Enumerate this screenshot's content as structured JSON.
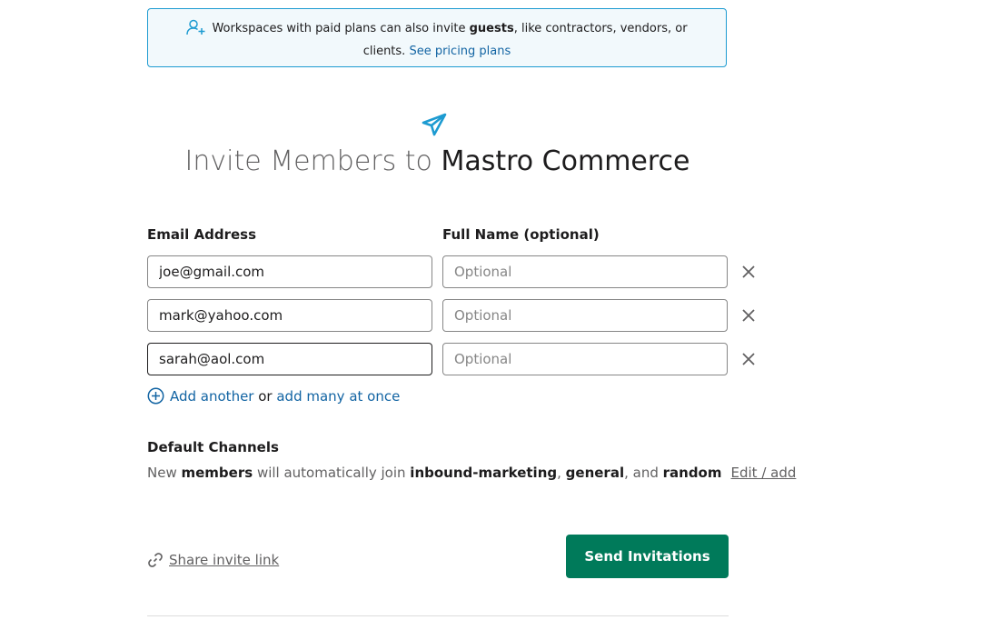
{
  "banner": {
    "text_before": "Workspaces with paid plans can also invite ",
    "bold": "guests",
    "text_after": ", like contractors, vendors, or clients. ",
    "link": "See pricing plans"
  },
  "header": {
    "title_prefix": "Invite Members to ",
    "workspace_name": "Mastro Commerce"
  },
  "form": {
    "email_label": "Email Address",
    "name_label": "Full Name (optional)",
    "rows": [
      {
        "email": "joe@gmail.com",
        "name_placeholder": "Optional"
      },
      {
        "email": "mark@yahoo.com",
        "name_placeholder": "Optional"
      },
      {
        "email": "sarah@aol.com",
        "name_placeholder": "Optional"
      }
    ],
    "add_another": "Add another",
    "or_text": " or ",
    "add_many": "add many at once"
  },
  "channels": {
    "title": "Default Channels",
    "text_new": "New ",
    "members": "members",
    "text_join": " will automatically join ",
    "ch1": "inbound-marketing",
    "sep1": ", ",
    "ch2": "general",
    "sep2": ", and ",
    "ch3": "random",
    "edit_link": "Edit / add"
  },
  "footer": {
    "share_link": "Share invite link",
    "send_button": "Send Invitations"
  },
  "colors": {
    "accent": "#007a5a",
    "link": "#1264a3",
    "banner_border": "#1d9bd1",
    "icon": "#1d9bd1"
  }
}
